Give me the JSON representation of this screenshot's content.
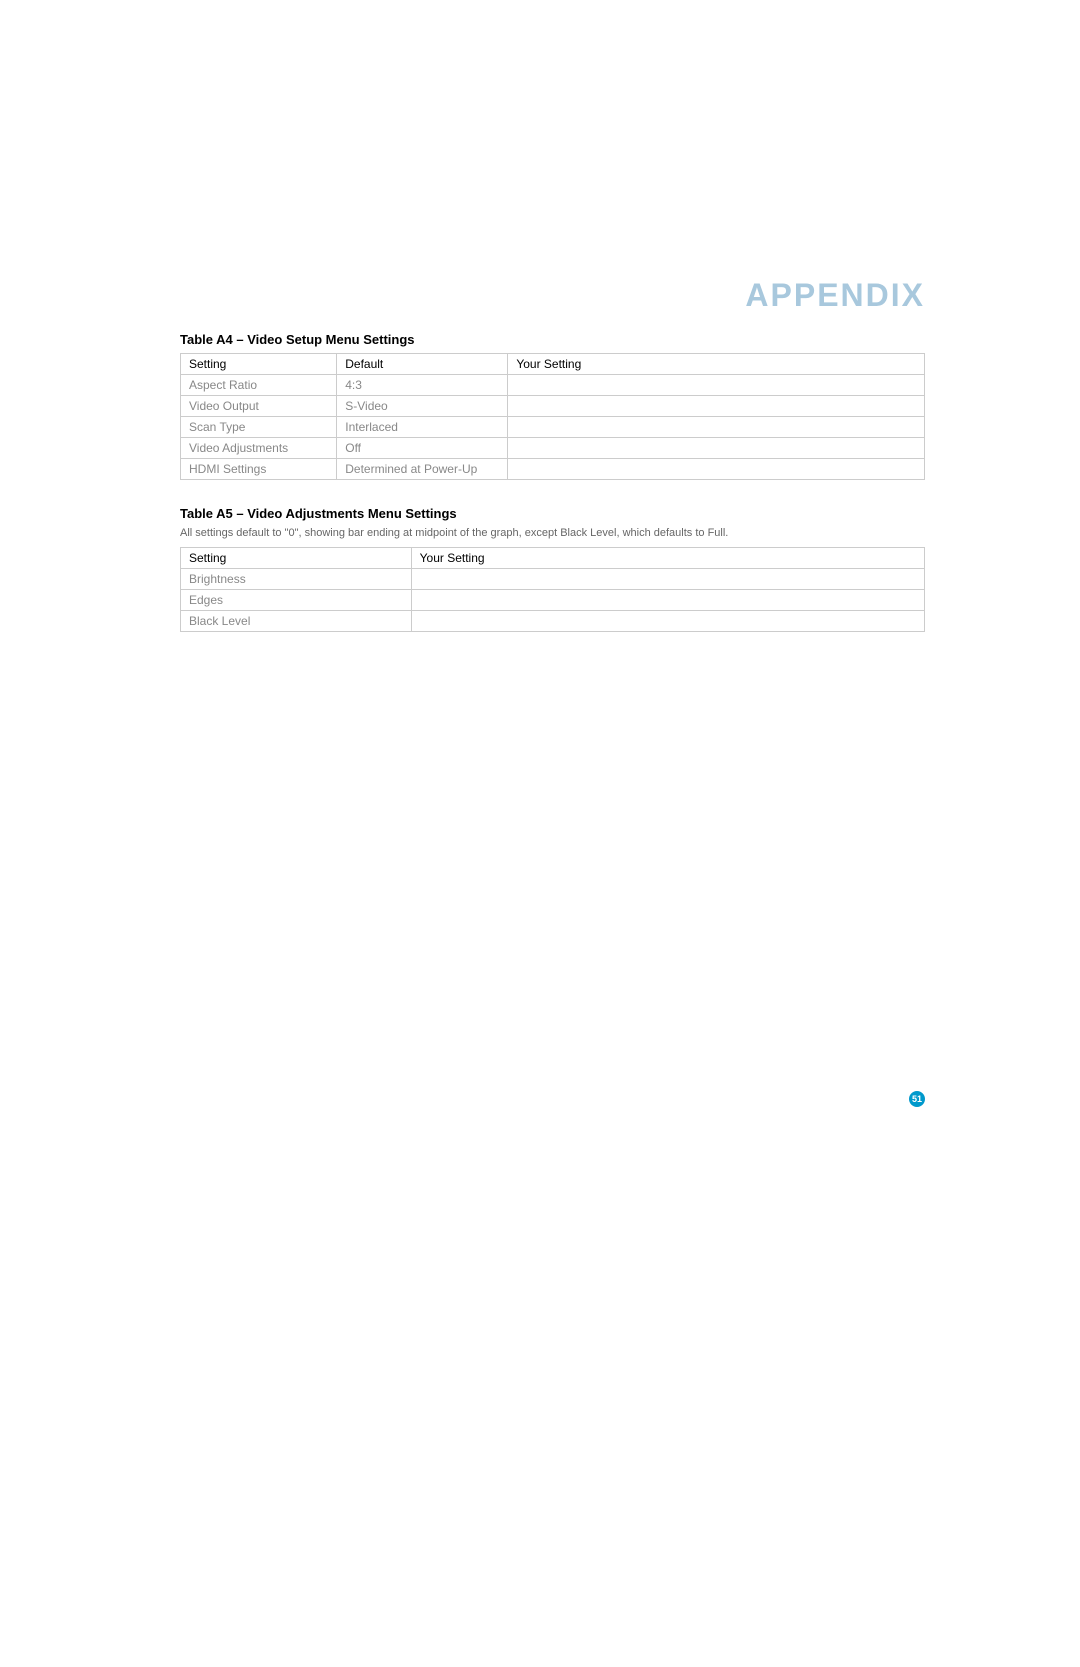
{
  "header": {
    "title": "APPENDIX"
  },
  "tableA4": {
    "caption": "Table A4 – Video Setup Menu Settings",
    "headers": [
      "Setting",
      "Default",
      "Your Setting"
    ],
    "rows": [
      {
        "setting": "Aspect Ratio",
        "default": "4:3",
        "your": ""
      },
      {
        "setting": "Video Output",
        "default": "S-Video",
        "your": ""
      },
      {
        "setting": "Scan Type",
        "default": "Interlaced",
        "your": ""
      },
      {
        "setting": "Video Adjustments",
        "default": "Off",
        "your": ""
      },
      {
        "setting": "HDMI Settings",
        "default": "Determined at Power-Up",
        "your": ""
      }
    ]
  },
  "tableA5": {
    "caption": "Table A5 – Video Adjustments Menu Settings",
    "note": "All settings default to \"0\", showing bar ending at midpoint of the graph, except Black Level, which defaults to Full.",
    "headers": [
      "Setting",
      "Your Setting"
    ],
    "rows": [
      {
        "setting": "Brightness",
        "your": ""
      },
      {
        "setting": "Edges",
        "your": ""
      },
      {
        "setting": "Black Level",
        "your": ""
      }
    ]
  },
  "page": {
    "number": "51"
  }
}
